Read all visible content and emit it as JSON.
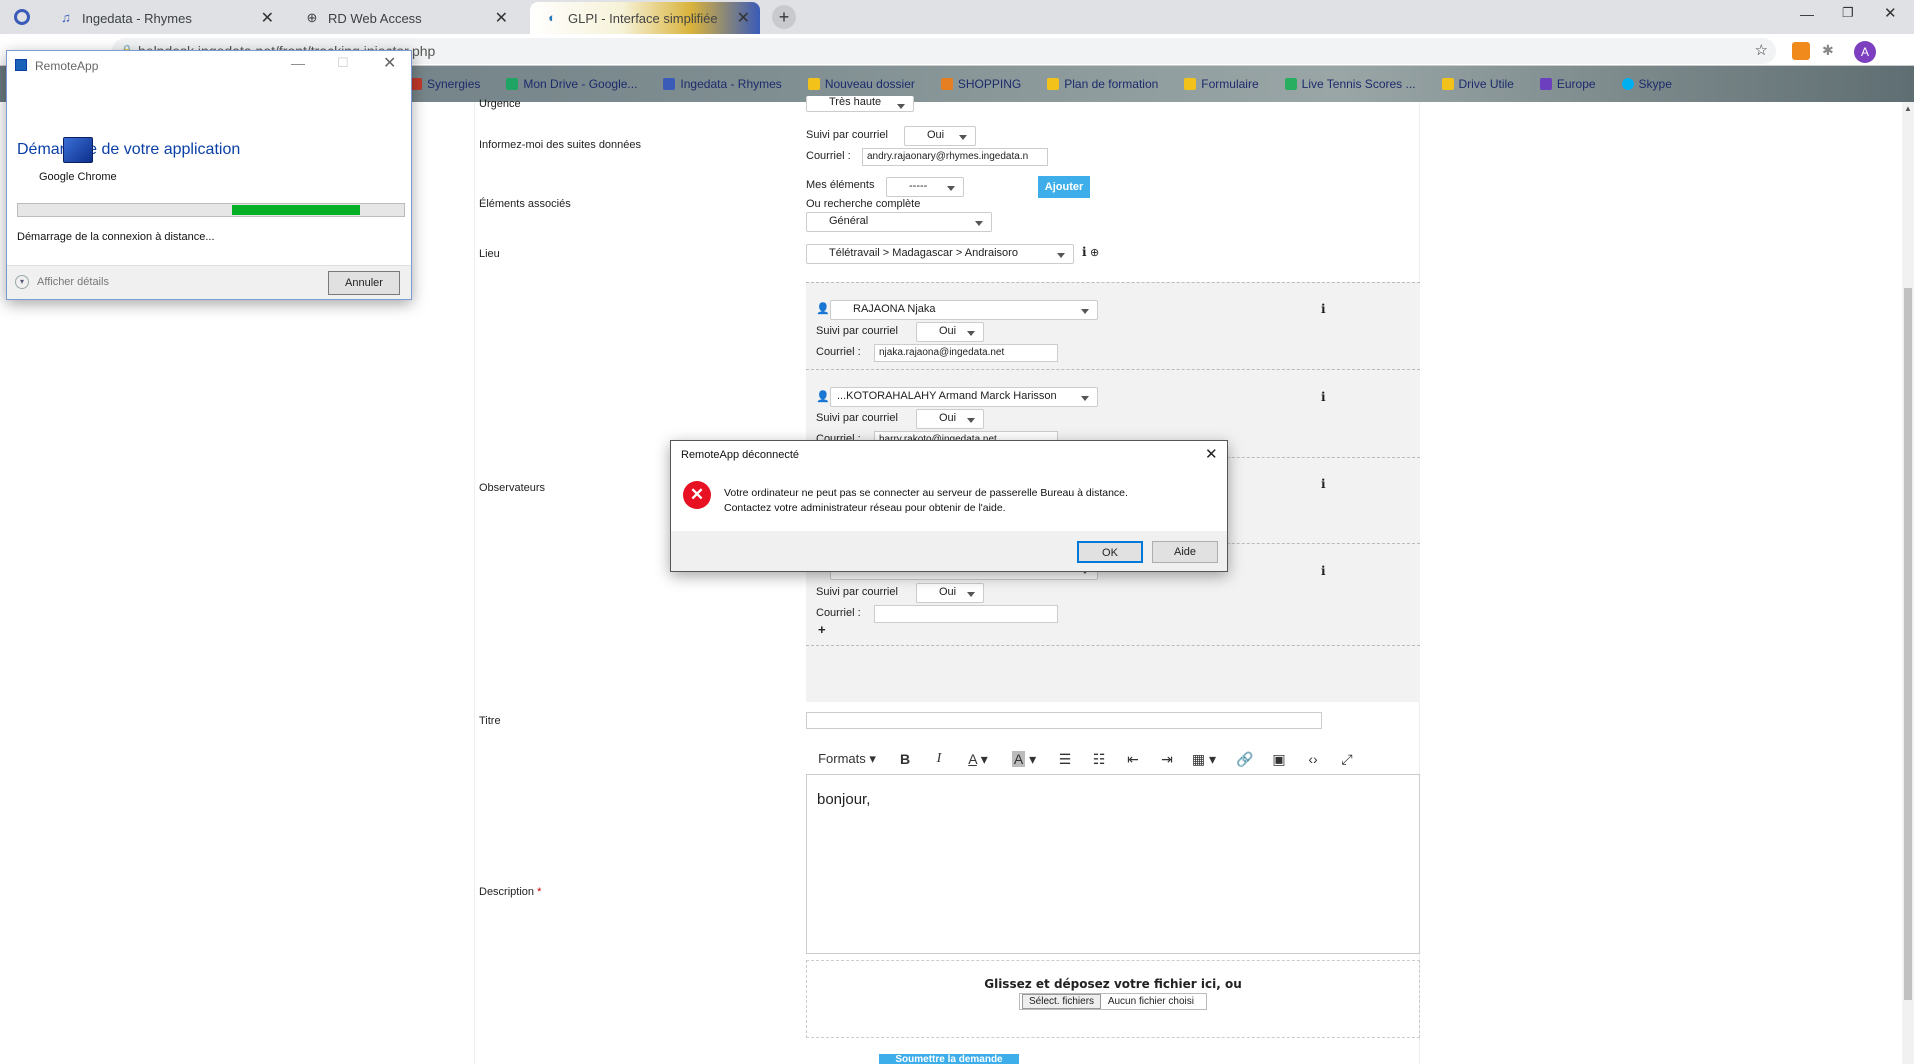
{
  "browser": {
    "tabs": [
      {
        "label": "Ingedata - Rhymes",
        "icon": "music-note-icon"
      },
      {
        "label": "RD Web Access",
        "icon": "globe-icon"
      },
      {
        "label": "GLPI - Interface simplifiée",
        "icon": "glpi-icon"
      }
    ],
    "url": "helpdesk.ingedata.net/front/tracking.injector.php",
    "profile_initial": "A",
    "bookmarks": [
      "Synergies",
      "Mon Drive - Google...",
      "Ingedata - Rhymes",
      "Nouveau dossier",
      "SHOPPING",
      "Plan de formation",
      "Formulaire",
      "Live Tennis Scores ...",
      "Drive Utile",
      "Europe",
      "Skype"
    ]
  },
  "form": {
    "urgence_label": "Urgence",
    "urgence_value": "Très haute",
    "inform_label": "Informez-moi des suites données",
    "suivi_label": "Suivi par courriel",
    "suivi_value": "Oui",
    "courriel_label": "Courriel :",
    "courriel_value": "andry.rajaonary@rhymes.ingedata.n",
    "elements_label": "Éléments associés",
    "mes_elements_label": "Mes éléments",
    "mes_elements_value": "-----",
    "ajouter_label": "Ajouter",
    "recherche_label": "Ou recherche complète",
    "recherche_value": "Général",
    "lieu_label": "Lieu",
    "lieu_value": "Télétravail > Madagascar > Andraisoro",
    "observateurs_label": "Observateurs",
    "observers": [
      {
        "name": "RAJAONA Njaka",
        "suivi": "Oui",
        "courriel": "njaka.rajaona@ingedata.net"
      },
      {
        "name": "...KOTORAHALAHY Armand Marck Harisson",
        "suivi": "Oui",
        "courriel": "harry.rakoto@ingedata.net"
      },
      {
        "name": "",
        "suivi": "",
        "courriel": ""
      },
      {
        "name": "-----",
        "suivi": "Oui",
        "courriel": ""
      }
    ],
    "add_observer": "+",
    "titre_label": "Titre",
    "description_label": "Description",
    "required_mark": "*",
    "editor_formats": "Formats",
    "editor_content": "bonjour,",
    "dropzone_text": "Glissez et déposez votre fichier ici, ou",
    "select_files": "Sélect. fichiers",
    "no_file": "Aucun fichier choisi",
    "submit_label": "Soumettre la demande"
  },
  "remoteapp_window": {
    "title": "RemoteApp",
    "heading": "Démarrage de votre application",
    "app_name": "Google Chrome",
    "progress": 0.6,
    "status": "Démarrage de la connexion à distance...",
    "details": "Afficher détails",
    "cancel": "Annuler"
  },
  "error_dialog": {
    "title": "RemoteApp déconnecté",
    "line1": "Votre ordinateur ne peut pas se connecter au serveur de passerelle Bureau à distance.",
    "line2": "Contactez votre administrateur réseau pour obtenir de l'aide.",
    "ok": "OK",
    "help": "Aide"
  },
  "colors": {
    "accent_blue": "#3daee9",
    "progress_green": "#06b025",
    "error_red": "#e81123",
    "win_title_blue": "#0a3fa6"
  }
}
